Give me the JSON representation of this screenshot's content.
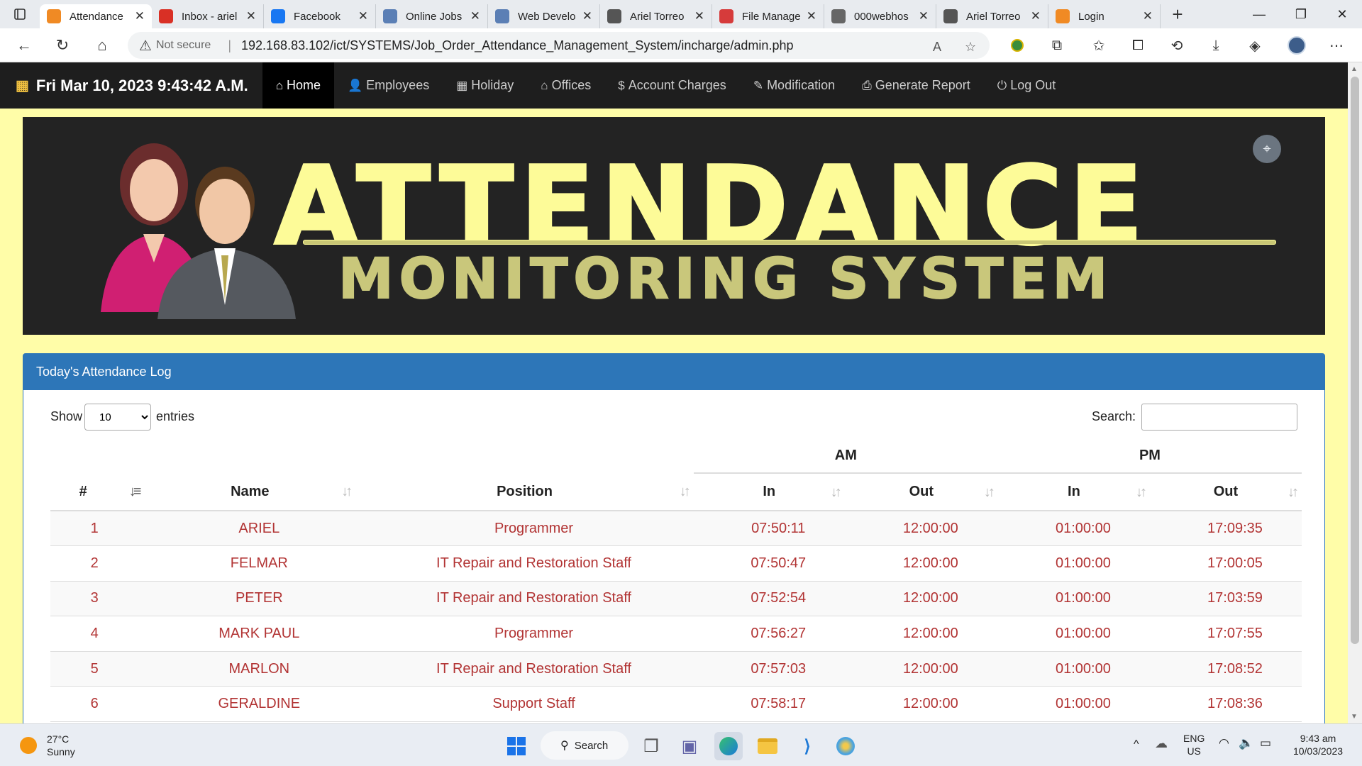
{
  "browser": {
    "tabs": [
      {
        "label": "Attendance",
        "icon": "xampp-icon",
        "color": "#f08a24",
        "active": true
      },
      {
        "label": "Inbox - ariel",
        "icon": "gmail-icon",
        "color": "#d93025",
        "active": false
      },
      {
        "label": "Facebook",
        "icon": "facebook-icon",
        "color": "#1877f2",
        "active": false
      },
      {
        "label": "Online Jobs",
        "icon": "globe-icon",
        "color": "#5b7fb5",
        "active": false
      },
      {
        "label": "Web Develo",
        "icon": "globe-icon",
        "color": "#5b7fb5",
        "active": false
      },
      {
        "label": "Ariel Torreo",
        "icon": "profile-icon",
        "color": "#555555",
        "active": false
      },
      {
        "label": "File Manage",
        "icon": "file-manager-icon",
        "color": "#d63b3b",
        "active": false
      },
      {
        "label": "000webhos",
        "icon": "page-icon",
        "color": "#666666",
        "active": false
      },
      {
        "label": "Ariel Torreo",
        "icon": "profile-icon",
        "color": "#555555",
        "active": false
      },
      {
        "label": "Login",
        "icon": "xampp-icon",
        "color": "#f08a24",
        "active": false
      }
    ],
    "not_secure": "Not secure",
    "url": "192.168.83.102/ict/SYSTEMS/Job_Order_Attendance_Management_System/incharge/admin.php"
  },
  "nav": {
    "clock": "Fri Mar 10, 2023 9:43:42 A.M.",
    "links": [
      {
        "label": "Home",
        "icon": "home-icon",
        "glyph": "⌂",
        "active": true
      },
      {
        "label": "Employees",
        "icon": "user-icon",
        "glyph": "👤",
        "active": false
      },
      {
        "label": "Holiday",
        "icon": "calendar-icon",
        "glyph": "▦",
        "active": false
      },
      {
        "label": "Offices",
        "icon": "home-icon",
        "glyph": "⌂",
        "active": false
      },
      {
        "label": "Account Charges",
        "icon": "dollar-icon",
        "glyph": "$",
        "active": false
      },
      {
        "label": "Modification",
        "icon": "pencil-icon",
        "glyph": "✎",
        "active": false
      },
      {
        "label": "Generate Report",
        "icon": "print-icon",
        "glyph": "⎙",
        "active": false
      },
      {
        "label": "Log Out",
        "icon": "power-icon",
        "glyph": "⏻",
        "active": false
      }
    ]
  },
  "banner": {
    "line1": "ATTENDANCE",
    "line2": "MONITORING SYSTEM"
  },
  "panel": {
    "title": "Today's Attendance Log",
    "show": "Show",
    "entries_value": "10",
    "entries": "entries",
    "search_label": "Search:"
  },
  "table": {
    "groups": {
      "am": "AM",
      "pm": "PM"
    },
    "headers": [
      "#",
      "Name",
      "Position",
      "In",
      "Out",
      "In",
      "Out"
    ],
    "rows": [
      [
        "1",
        "ARIEL",
        "Programmer",
        "07:50:11",
        "12:00:00",
        "01:00:00",
        "17:09:35"
      ],
      [
        "2",
        "FELMAR",
        "IT Repair and Restoration Staff",
        "07:50:47",
        "12:00:00",
        "01:00:00",
        "17:00:05"
      ],
      [
        "3",
        "PETER",
        "IT Repair and Restoration Staff",
        "07:52:54",
        "12:00:00",
        "01:00:00",
        "17:03:59"
      ],
      [
        "4",
        "MARK PAUL",
        "Programmer",
        "07:56:27",
        "12:00:00",
        "01:00:00",
        "17:07:55"
      ],
      [
        "5",
        "MARLON",
        "IT Repair and Restoration Staff",
        "07:57:03",
        "12:00:00",
        "01:00:00",
        "17:08:52"
      ],
      [
        "6",
        "GERALDINE",
        "Support Staff",
        "07:58:17",
        "12:00:00",
        "01:00:00",
        "17:08:36"
      ]
    ]
  },
  "taskbar": {
    "temp": "27°C",
    "condition": "Sunny",
    "search": "Search",
    "lang1": "ENG",
    "lang2": "US",
    "time": "9:43 am",
    "date": "10/03/2023"
  },
  "colors": {
    "page_bg": "#fffda8",
    "nav_bg": "#1e1e1e",
    "panel_header": "#2d76b8",
    "cell_text": "#b23434",
    "banner_text": "#fdfb98"
  }
}
